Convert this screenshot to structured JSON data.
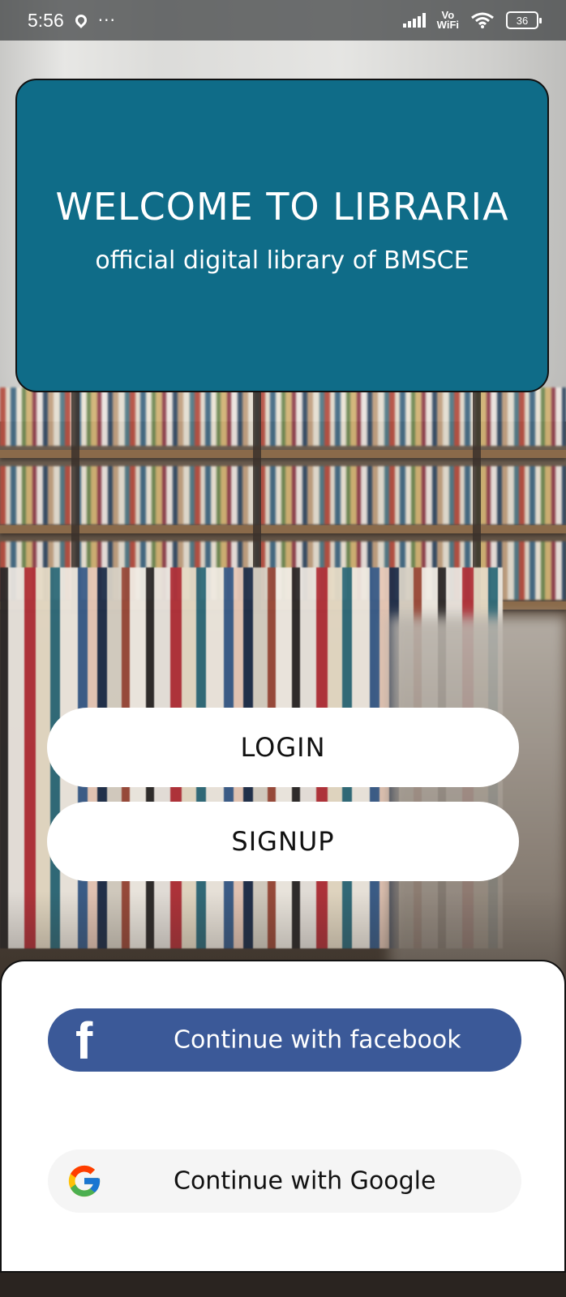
{
  "status_bar": {
    "time": "5:56",
    "more_indicator": "···",
    "network_label_top": "Vo",
    "network_label_bottom": "WiFi",
    "battery": "36",
    "icons": [
      "location-icon",
      "signal-icon",
      "wifi-icon",
      "battery-icon"
    ]
  },
  "welcome": {
    "title": "WELCOME TO LIBRARIA",
    "subtitle": "official digital library of BMSCE",
    "background_color": "#0f6c88"
  },
  "buttons": {
    "login": "LOGIN",
    "signup": "SIGNUP"
  },
  "social": {
    "facebook_label": "Continue with facebook",
    "facebook_icon": "facebook-icon",
    "facebook_color": "#3b5998",
    "google_label": "Continue with Google",
    "google_icon": "google-icon"
  }
}
